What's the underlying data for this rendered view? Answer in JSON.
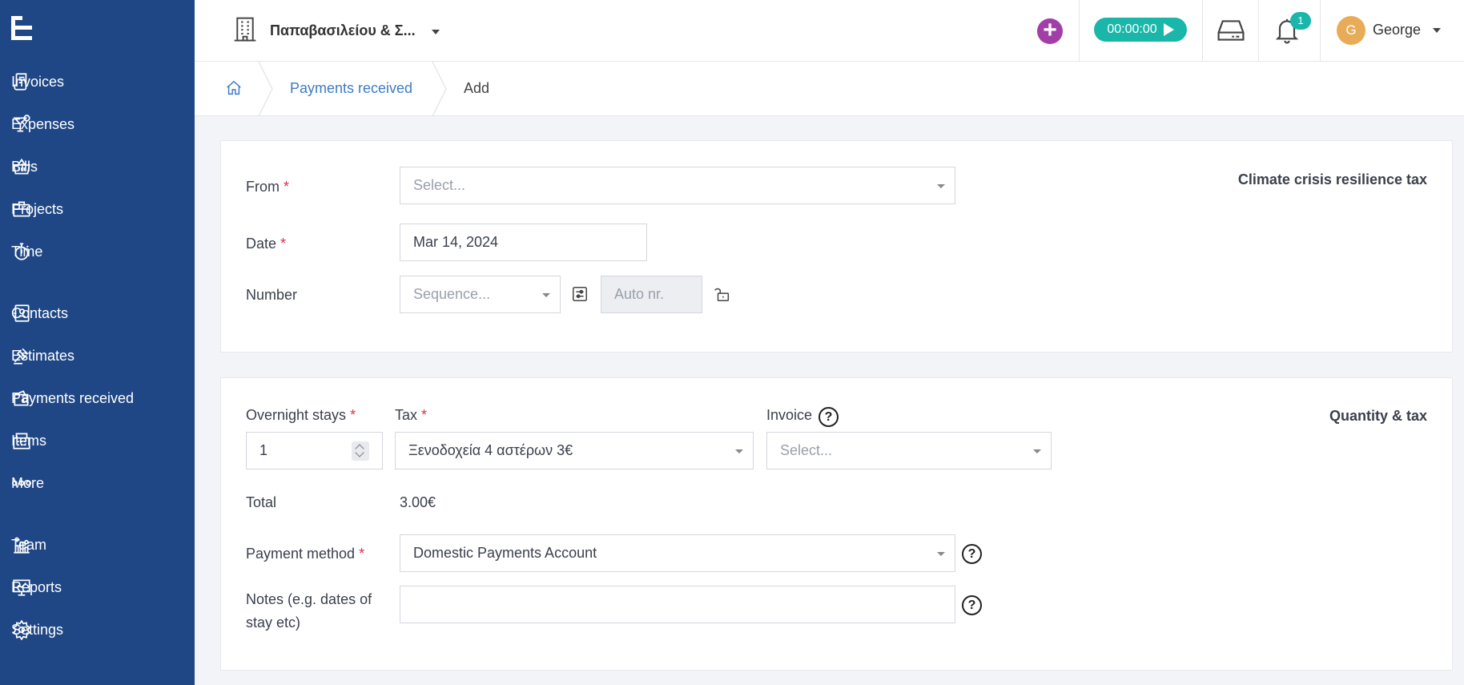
{
  "sidebar": {
    "items": [
      {
        "label": "Invoices"
      },
      {
        "label": "Expenses"
      },
      {
        "label": "Bills"
      },
      {
        "label": "Projects"
      },
      {
        "label": "Time"
      },
      {
        "label": "Contacts"
      },
      {
        "label": "Estimates"
      },
      {
        "label": "Payments received"
      },
      {
        "label": "Items"
      },
      {
        "label": "More"
      },
      {
        "label": "Team"
      },
      {
        "label": "Reports"
      },
      {
        "label": "Settings"
      }
    ]
  },
  "header": {
    "company": "Παπαβασιλείου & Σ...",
    "timer": "00:00:00",
    "notification_count": "1",
    "user_initial": "G",
    "user_name": "George"
  },
  "breadcrumb": {
    "parent": "Payments received",
    "current": "Add"
  },
  "card1": {
    "title": "Climate crisis resilience tax",
    "from_label": "From",
    "from_placeholder": "Select...",
    "date_label": "Date",
    "date_value": "Mar 14, 2024",
    "number_label": "Number",
    "sequence_placeholder": "Sequence...",
    "auto_placeholder": "Auto nr.",
    "required_mark": "*"
  },
  "card2": {
    "title": "Quantity & tax",
    "stays_label": "Overnight stays",
    "stays_value": "1",
    "tax_label": "Tax",
    "tax_value": "Ξενοδοχεία 4 αστέρων 3€",
    "invoice_label": "Invoice",
    "invoice_placeholder": "Select...",
    "total_label": "Total",
    "total_value": "3.00€",
    "payment_label": "Payment method",
    "payment_value": "Domestic Payments Account",
    "notes_label_line1": "Notes (e.g. dates of",
    "notes_label_line2": "stay etc)",
    "notes_value": "",
    "help_glyph": "?"
  },
  "colors": {
    "sidebar_bg": "#1f4785",
    "accent_teal": "#1ab6aa",
    "add_button": "#a23ea8",
    "avatar": "#e8ac58",
    "link": "#3d7bc4",
    "required": "#d9304e"
  }
}
